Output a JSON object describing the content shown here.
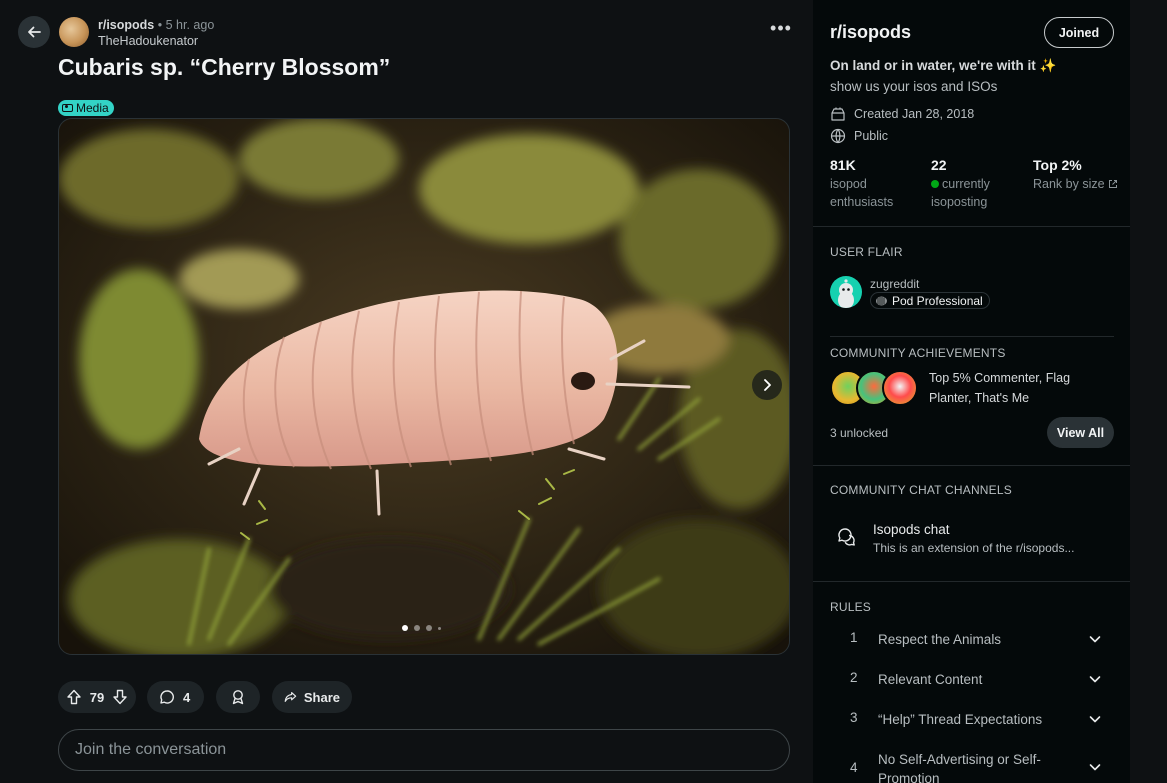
{
  "post": {
    "subreddit": "r/isopods",
    "separator": "•",
    "time": "5 hr. ago",
    "author": "TheHadoukenator",
    "title": "Cubaris sp. “Cherry Blossom”",
    "flair": "Media",
    "gallery": {
      "current": 1,
      "total": 4
    },
    "votes": "79",
    "comments": "4",
    "share_label": "Share",
    "comment_placeholder": "Join the conversation"
  },
  "sidebar": {
    "name": "r/isopods",
    "joined_label": "Joined",
    "tagline": "On land or in water, we're with it ✨",
    "description": "show us your isos and ISOs",
    "created": "Created Jan 28, 2018",
    "visibility": "Public",
    "stats": [
      {
        "value": "81K",
        "label_line1": "isopod",
        "label_line2": "enthusiasts"
      },
      {
        "value": "22",
        "label_line1": "currently",
        "label_line2": "isoposting"
      },
      {
        "value": "Top 2%",
        "label_line1": "Rank by size"
      }
    ],
    "user_flair_heading": "USER FLAIR",
    "user_flair_name": "zugreddit",
    "user_flair_tag": "Pod Professional",
    "achievements_heading": "COMMUNITY ACHIEVEMENTS",
    "achievements_text": "Top 5% Commenter, Flag Planter, That's Me",
    "unlocked": "3 unlocked",
    "view_all_label": "View All",
    "chat_heading": "COMMUNITY CHAT CHANNELS",
    "chat_title": "Isopods chat",
    "chat_desc": "This is an extension of the r/isopods...",
    "rules_heading": "RULES",
    "rules": [
      {
        "num": "1",
        "text": "Respect the Animals"
      },
      {
        "num": "2",
        "text": "Relevant Content"
      },
      {
        "num": "3",
        "text": "“Help” Thread Expectations"
      },
      {
        "num": "4",
        "text": "No Self-Advertising or Self-Promotion"
      }
    ]
  },
  "colors": {
    "background": "#0e1113",
    "sidebar": "#04090a",
    "flair": "#33d3c6",
    "online": "#01a816"
  },
  "icons": [
    "back-arrow-icon",
    "more-icon",
    "camera-icon",
    "chevron-right-icon",
    "upvote-icon",
    "downvote-icon",
    "comment-icon",
    "award-icon",
    "share-icon",
    "calendar-icon",
    "globe-icon",
    "external-link-icon",
    "chat-icon",
    "chevron-down-icon"
  ]
}
